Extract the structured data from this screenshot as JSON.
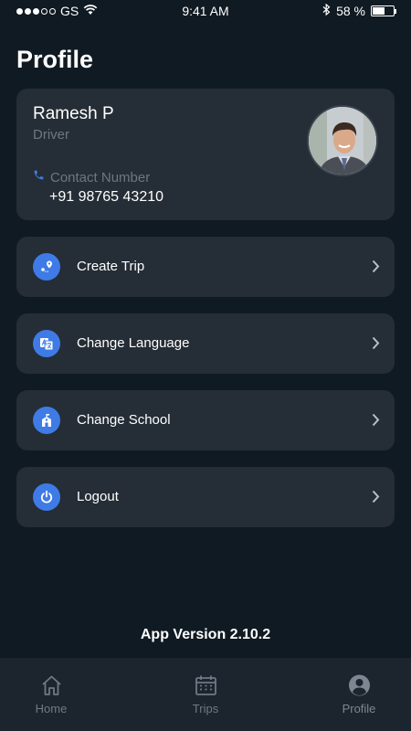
{
  "status_bar": {
    "carrier": "GS",
    "time": "9:41 AM",
    "battery": "58 %",
    "battery_level": 0.58
  },
  "page": {
    "title": "Profile"
  },
  "profile": {
    "name": "Ramesh P",
    "role": "Driver",
    "contact_label": "Contact Number",
    "phone": "+91 98765 43210"
  },
  "menu": [
    {
      "label": "Create Trip",
      "icon": "map-pin-icon"
    },
    {
      "label": "Change Language",
      "icon": "translate-icon"
    },
    {
      "label": "Change School",
      "icon": "school-icon"
    },
    {
      "label": "Logout",
      "icon": "power-icon"
    }
  ],
  "footer": {
    "app_version": "App Version 2.10.2"
  },
  "tabs": [
    {
      "label": "Home",
      "icon": "home-icon"
    },
    {
      "label": "Trips",
      "icon": "calendar-icon"
    },
    {
      "label": "Profile",
      "icon": "user-icon",
      "active": true
    }
  ],
  "colors": {
    "background": "#101a22",
    "card": "#252d36",
    "accent": "#3f7be6",
    "muted_text": "#6d7782"
  }
}
